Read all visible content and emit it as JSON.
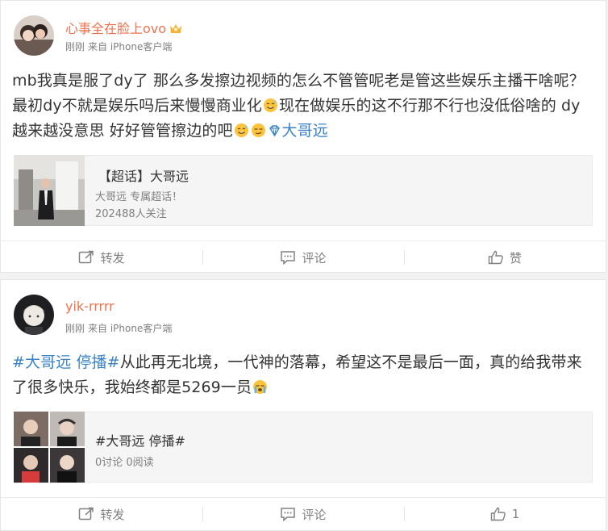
{
  "posts": [
    {
      "username": "心事全在脸上ovo",
      "time": "刚刚",
      "source": "来自 iPhone客户端",
      "text": "mb我真是服了dy了 那么多发擦边视频的怎么不管管呢老是管这些娱乐主播干啥呢？最初dy不就是娱乐吗后来慢慢商业化",
      "text2": "现在做娱乐的这不行那不行也没低俗啥的 dy越来越没意思 好好管管擦边的吧",
      "tag_link": "大哥远",
      "embed": {
        "title": "【超话】大哥远",
        "line1": "大哥远 专属超话！",
        "line2": "202488人关注"
      },
      "actions": {
        "repost": "转发",
        "comment": "评论",
        "like": "赞"
      }
    },
    {
      "username": "yik-rrrrr",
      "time": "刚刚",
      "source": "来自 iPhone客户端",
      "topic": "#大哥远 停播#",
      "text": "从此再无北境，一代神的落幕，希望这不是最后一面，真的给我带来了很多快乐，我始终都是5269一员",
      "embed": {
        "title": "#大哥远 停播#",
        "line1": "0讨论 0阅读"
      },
      "actions": {
        "repost": "转发",
        "comment": "评论",
        "like": "1"
      }
    }
  ],
  "colors": {
    "username": "#eb7350",
    "link": "#3b83c5",
    "meta": "#808080"
  }
}
